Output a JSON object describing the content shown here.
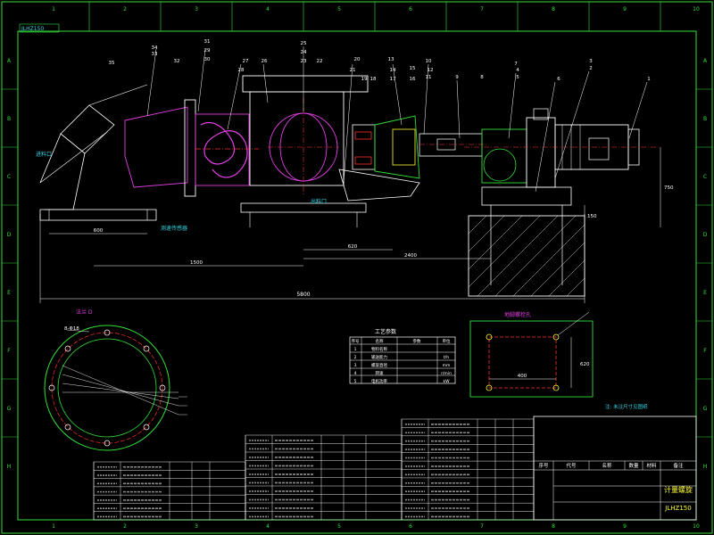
{
  "drawing": {
    "title_block": {
      "title": "计量螺旋",
      "code": "JLHZ150",
      "headers": [
        "序号",
        "代号",
        "名称",
        "数量",
        "材料",
        "备注"
      ],
      "top_tag": "JLHZ150"
    },
    "process_table": {
      "title": "工艺参数",
      "headers": [
        "序号",
        "名称",
        "参数",
        "单位"
      ],
      "rows": [
        [
          "1",
          "物料名称",
          "",
          ""
        ],
        [
          "2",
          "输送能力",
          "",
          "t/h"
        ],
        [
          "3",
          "螺旋直径",
          "",
          "mm"
        ],
        [
          "4",
          "转速",
          "",
          "r/min"
        ],
        [
          "5",
          "电机功率",
          "",
          "kW"
        ]
      ]
    },
    "views": {
      "section_a": "法兰 D",
      "section_b": "地脚螺栓孔",
      "bolt_label": "8-Φ18",
      "note": "注: 未注尺寸见图纸",
      "sensor_label": "测速传感器",
      "inlet_label": "进料口",
      "outlet_label": "出料口"
    },
    "dimensions": {
      "overall_length": "5800",
      "span_a": "1500",
      "span_b": "2400",
      "height": "750",
      "width_a": "600",
      "width_b": "400",
      "base_h": "150",
      "mid": "620"
    },
    "callouts": [
      "1",
      "2",
      "3",
      "4",
      "5",
      "6",
      "7",
      "8",
      "9",
      "10",
      "11",
      "12",
      "13",
      "14",
      "15",
      "16",
      "17",
      "18",
      "19",
      "20",
      "21",
      "22",
      "23",
      "24",
      "25",
      "26",
      "27",
      "28",
      "29",
      "30",
      "31",
      "32",
      "33",
      "34",
      "35"
    ],
    "zones_top": [
      "1",
      "2",
      "3",
      "4",
      "5",
      "6",
      "7",
      "8",
      "9",
      "10"
    ],
    "zones_side": [
      "A",
      "B",
      "C",
      "D",
      "E",
      "F",
      "G",
      "H"
    ]
  },
  "colors": {
    "border": "#33e03a",
    "magenta": "#e040e0",
    "cyan": "#35d6e6",
    "red": "#ff3030",
    "yellow": "#ffff33"
  }
}
